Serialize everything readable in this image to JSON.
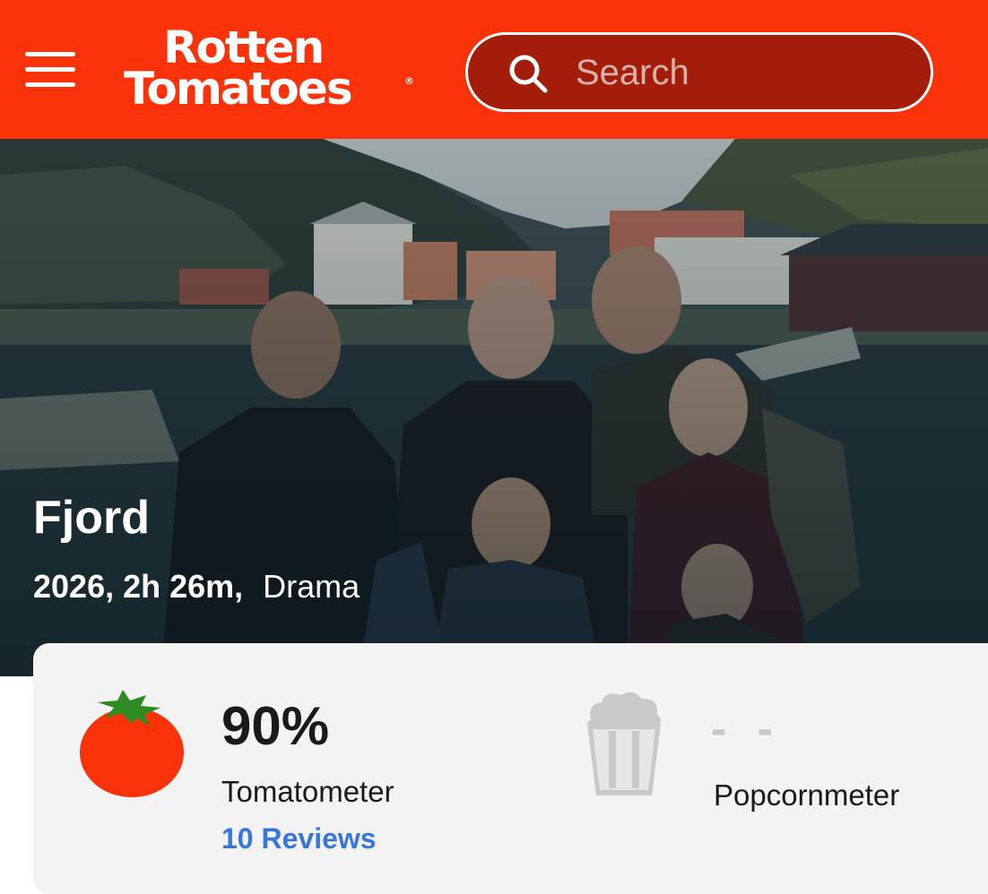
{
  "header": {
    "logo_line1": "Rotten",
    "logo_line2": "Tomatoes",
    "logo_reg": "®",
    "search_placeholder": "Search",
    "brand_color": "#fa320a"
  },
  "movie": {
    "title": "Fjord",
    "info": "2026, 2h 26m,",
    "genre": "Drama"
  },
  "scores": {
    "tomatometer": {
      "value": "90%",
      "label": "Tomatometer",
      "reviews": "10 Reviews",
      "icon": "tomato-icon",
      "color": "#fa320a"
    },
    "popcornmeter": {
      "value": "- -",
      "label": "Popcornmeter",
      "icon": "popcorn-bucket-icon"
    }
  },
  "link_color": "#3976dc"
}
